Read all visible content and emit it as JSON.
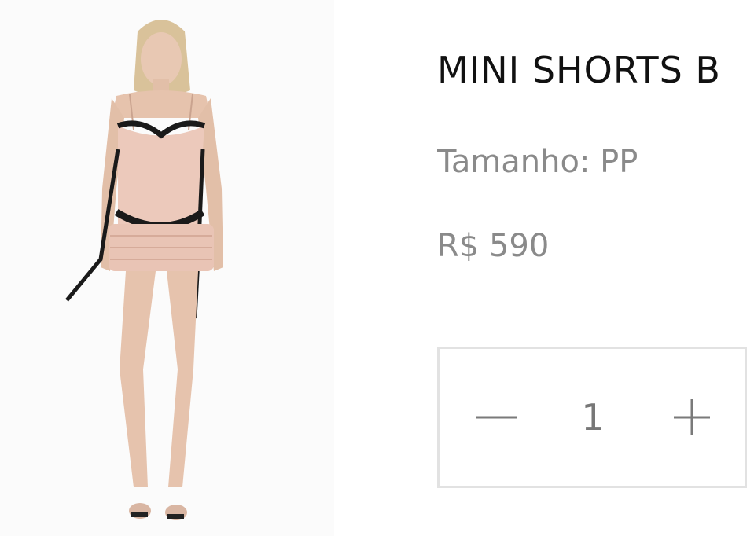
{
  "product": {
    "title": "MINI SHORTS B",
    "size_text": "Tamanho: PP",
    "price": "R$ 590",
    "image_alt": "model wearing pink lace slip top with black trim and ruffled mini shorts"
  },
  "quantity": {
    "minus_icon": "minus-icon",
    "plus_icon": "plus-icon",
    "value": "1"
  },
  "colors": {
    "title": "#111111",
    "muted_text": "#8a8a8a",
    "box_border": "#e2e2e2",
    "blush": "#e9c4b5",
    "lace_black": "#1a1a1a"
  }
}
